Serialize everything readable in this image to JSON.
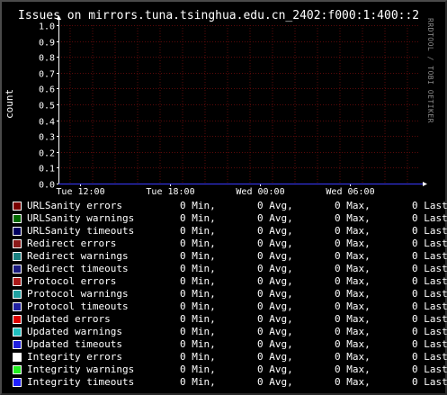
{
  "title": "Issues on mirrors.tuna.tsinghua.edu.cn_2402:f000:1:400::2",
  "watermark": "RRDTOOL / TOBI OETIKER",
  "chart_data": {
    "type": "line",
    "ylabel": "count",
    "xlabel": "",
    "ylim": [
      0,
      1.0
    ],
    "y_ticks": [
      "0.0",
      "0.1",
      "0.2",
      "0.3",
      "0.4",
      "0.5",
      "0.6",
      "0.7",
      "0.8",
      "0.9",
      "1.0"
    ],
    "x_ticks": [
      "Tue 12:00",
      "Tue 18:00",
      "Wed 00:00",
      "Wed 06:00"
    ],
    "grid": true,
    "series_values": "all series 0 across the full time range"
  },
  "legend": {
    "min_label": "Min,",
    "avg_label": "Avg,",
    "max_label": "Max,",
    "last_label": "Last",
    "items": [
      {
        "name": "URLSanity errors",
        "color": "#7a0000",
        "min": "0",
        "avg": "0",
        "max": "0"
      },
      {
        "name": "URLSanity warnings",
        "color": "#006a00",
        "min": "0",
        "avg": "0",
        "max": "0"
      },
      {
        "name": "URLSanity timeouts",
        "color": "#000060",
        "min": "0",
        "avg": "0",
        "max": "0"
      },
      {
        "name": "Redirect errors",
        "color": "#8b1a1a",
        "min": "0",
        "avg": "0",
        "max": "0"
      },
      {
        "name": "Redirect warnings",
        "color": "#1a8080",
        "min": "0",
        "avg": "0",
        "max": "0"
      },
      {
        "name": "Redirect timeouts",
        "color": "#1a1a80",
        "min": "0",
        "avg": "0",
        "max": "0"
      },
      {
        "name": "Protocol errors",
        "color": "#aa1a1a",
        "min": "0",
        "avg": "0",
        "max": "0"
      },
      {
        "name": "Protocol warnings",
        "color": "#20a0a0",
        "min": "0",
        "avg": "0",
        "max": "0"
      },
      {
        "name": "Protocol timeouts",
        "color": "#2020a0",
        "min": "0",
        "avg": "0",
        "max": "0"
      },
      {
        "name": "Updated errors",
        "color": "#dd0000",
        "min": "0",
        "avg": "0",
        "max": "0"
      },
      {
        "name": "Updated warnings",
        "color": "#20c0c0",
        "min": "0",
        "avg": "0",
        "max": "0"
      },
      {
        "name": "Updated timeouts",
        "color": "#2020e0",
        "min": "0",
        "avg": "0",
        "max": "0"
      },
      {
        "name": "Integrity errors",
        "color": "#ffffff",
        "min": "0",
        "avg": "0",
        "max": "0"
      },
      {
        "name": "Integrity warnings",
        "color": "#20ee20",
        "min": "0",
        "avg": "0",
        "max": "0"
      },
      {
        "name": "Integrity timeouts",
        "color": "#2020ff",
        "min": "0",
        "avg": "0",
        "max": "0"
      }
    ]
  },
  "colors": {
    "background": "#000000",
    "grid": "#5a0a0a",
    "axis": "#ffffff",
    "zero_line": "#3a3aff"
  }
}
